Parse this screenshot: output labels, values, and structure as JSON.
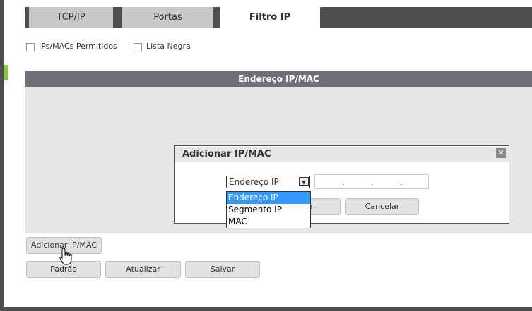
{
  "tabs": [
    {
      "label": "TCP/IP"
    },
    {
      "label": "Portas"
    },
    {
      "label": "Filtro IP"
    }
  ],
  "filters": {
    "allowed_label": "IPs/MACs Permitidos",
    "blacklist_label": "Lista Negra"
  },
  "table": {
    "header": "Endereço IP/MAC"
  },
  "dialog": {
    "title": "Adicionar IP/MAC",
    "close_glyph": "✕",
    "select_value": "Endereço IP",
    "arrow_glyph": "▼",
    "ip_separator": ".",
    "options": [
      "Endereço IP",
      "Segmento IP",
      "MAC"
    ],
    "ok_label": "r",
    "cancel_label": "Cancelar"
  },
  "buttons": {
    "add_label": "Adicionar IP/MAC",
    "default_label": "Padrão",
    "refresh_label": "Atualizar",
    "save_label": "Salvar"
  },
  "colors": {
    "accent_green": "#8cc63f",
    "dark_frame": "#4e4e4e",
    "selection_blue": "#3399ff"
  }
}
